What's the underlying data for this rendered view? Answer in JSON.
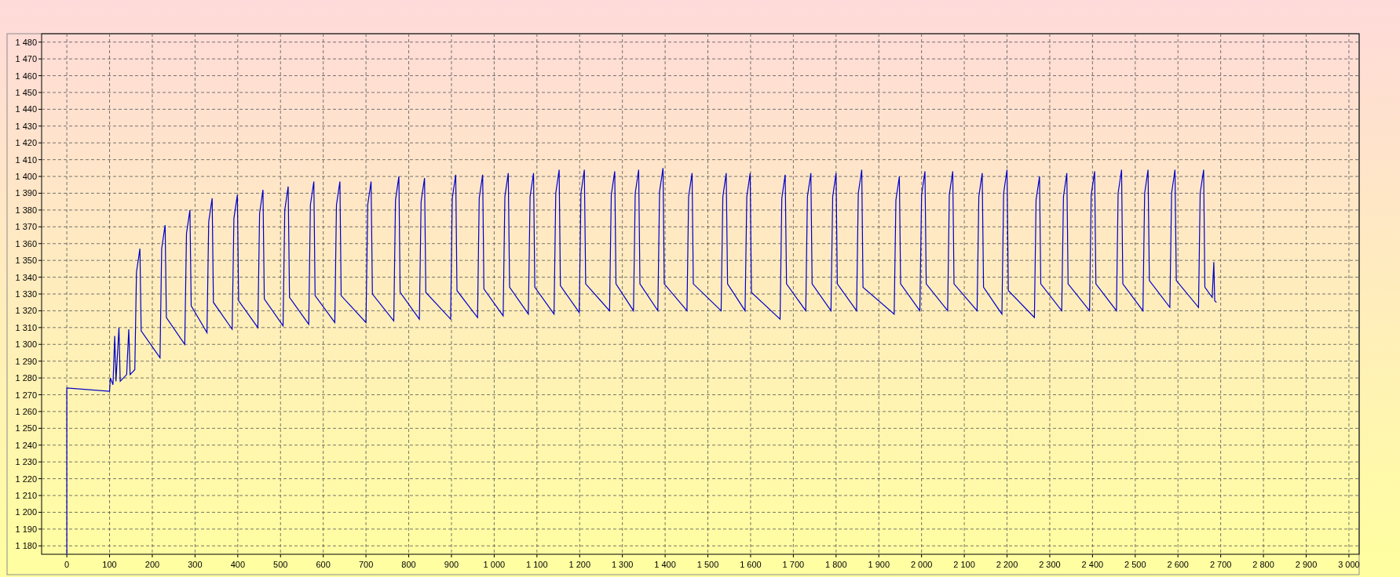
{
  "chart": {
    "chart_data": {
      "type": "line",
      "grid": true,
      "xlim": [
        -59,
        3024
      ],
      "ylim": [
        1175,
        1485
      ],
      "xticks": [
        {
          "value": 0,
          "label": "0"
        },
        {
          "value": 100,
          "label": "100"
        },
        {
          "value": 200,
          "label": "200"
        },
        {
          "value": 300,
          "label": "300"
        },
        {
          "value": 400,
          "label": "400"
        },
        {
          "value": 500,
          "label": "500"
        },
        {
          "value": 600,
          "label": "600"
        },
        {
          "value": 700,
          "label": "700"
        },
        {
          "value": 800,
          "label": "800"
        },
        {
          "value": 900,
          "label": "900"
        },
        {
          "value": 1000,
          "label": "1 000"
        },
        {
          "value": 1100,
          "label": "1 100"
        },
        {
          "value": 1200,
          "label": "1 200"
        },
        {
          "value": 1300,
          "label": "1 300"
        },
        {
          "value": 1400,
          "label": "1 400"
        },
        {
          "value": 1500,
          "label": "1 500"
        },
        {
          "value": 1600,
          "label": "1 600"
        },
        {
          "value": 1700,
          "label": "1 700"
        },
        {
          "value": 1800,
          "label": "1 800"
        },
        {
          "value": 1900,
          "label": "1 900"
        },
        {
          "value": 2000,
          "label": "2 000"
        },
        {
          "value": 2100,
          "label": "2 100"
        },
        {
          "value": 2200,
          "label": "2 200"
        },
        {
          "value": 2300,
          "label": "2 300"
        },
        {
          "value": 2400,
          "label": "2 400"
        },
        {
          "value": 2500,
          "label": "2 500"
        },
        {
          "value": 2600,
          "label": "2 600"
        },
        {
          "value": 2700,
          "label": "2 700"
        },
        {
          "value": 2800,
          "label": "2 800"
        },
        {
          "value": 2900,
          "label": "2 900"
        },
        {
          "value": 3000,
          "label": "3 000"
        }
      ],
      "yticks": [
        {
          "value": 1180,
          "label": "1 180"
        },
        {
          "value": 1190,
          "label": "1 190"
        },
        {
          "value": 1200,
          "label": "1 200"
        },
        {
          "value": 1210,
          "label": "1 210"
        },
        {
          "value": 1220,
          "label": "1 220"
        },
        {
          "value": 1230,
          "label": "1 230"
        },
        {
          "value": 1240,
          "label": "1 240"
        },
        {
          "value": 1250,
          "label": "1 250"
        },
        {
          "value": 1260,
          "label": "1 260"
        },
        {
          "value": 1270,
          "label": "1 270"
        },
        {
          "value": 1280,
          "label": "1 280"
        },
        {
          "value": 1290,
          "label": "1 290"
        },
        {
          "value": 1300,
          "label": "1 300"
        },
        {
          "value": 1310,
          "label": "1 310"
        },
        {
          "value": 1320,
          "label": "1 320"
        },
        {
          "value": 1330,
          "label": "1 330"
        },
        {
          "value": 1340,
          "label": "1 340"
        },
        {
          "value": 1350,
          "label": "1 350"
        },
        {
          "value": 1360,
          "label": "1 360"
        },
        {
          "value": 1370,
          "label": "1 370"
        },
        {
          "value": 1380,
          "label": "1 380"
        },
        {
          "value": 1390,
          "label": "1 390"
        },
        {
          "value": 1400,
          "label": "1 400"
        },
        {
          "value": 1410,
          "label": "1 410"
        },
        {
          "value": 1420,
          "label": "1 420"
        },
        {
          "value": 1430,
          "label": "1 430"
        },
        {
          "value": 1440,
          "label": "1 440"
        },
        {
          "value": 1450,
          "label": "1 450"
        },
        {
          "value": 1460,
          "label": "1 460"
        },
        {
          "value": 1470,
          "label": "1 470"
        },
        {
          "value": 1480,
          "label": "1 480"
        }
      ],
      "x": [
        0,
        0,
        100,
        102,
        108,
        112,
        115,
        122,
        125,
        140,
        145,
        148,
        159,
        163,
        171,
        174,
        218,
        222,
        230,
        233,
        276,
        280,
        288,
        291,
        328,
        332,
        340,
        343,
        387,
        391,
        399,
        402,
        447,
        451,
        459,
        462,
        506,
        510,
        518,
        521,
        566,
        570,
        578,
        581,
        627,
        631,
        639,
        642,
        700,
        704,
        712,
        715,
        765,
        769,
        777,
        780,
        825,
        829,
        837,
        840,
        898,
        902,
        910,
        913,
        961,
        965,
        973,
        976,
        1021,
        1025,
        1033,
        1036,
        1080,
        1084,
        1092,
        1095,
        1140,
        1144,
        1152,
        1155,
        1199,
        1203,
        1211,
        1214,
        1270,
        1274,
        1282,
        1285,
        1326,
        1330,
        1338,
        1341,
        1383,
        1387,
        1395,
        1398,
        1451,
        1455,
        1463,
        1466,
        1531,
        1535,
        1543,
        1546,
        1587,
        1591,
        1599,
        1602,
        1669,
        1673,
        1681,
        1684,
        1729,
        1733,
        1741,
        1744,
        1788,
        1792,
        1800,
        1803,
        1848,
        1852,
        1860,
        1863,
        1936,
        1940,
        1948,
        1951,
        1996,
        2000,
        2008,
        2011,
        2061,
        2065,
        2073,
        2076,
        2130,
        2134,
        2142,
        2145,
        2188,
        2192,
        2200,
        2203,
        2264,
        2268,
        2276,
        2279,
        2328,
        2332,
        2340,
        2343,
        2393,
        2397,
        2405,
        2408,
        2456,
        2460,
        2468,
        2471,
        2518,
        2522,
        2530,
        2533,
        2581,
        2585,
        2593,
        2596,
        2648,
        2652,
        2660,
        2663,
        2680,
        2684,
        2686,
        2690
      ],
      "series": [
        {
          "color": "#0000c8",
          "values": [
            1175,
            1274,
            1272,
            1280,
            1276,
            1305,
            1278,
            1310,
            1278,
            1282,
            1309,
            1282,
            1285,
            1343,
            1357,
            1308,
            1292,
            1357,
            1371,
            1316,
            1300,
            1366,
            1380,
            1323,
            1307,
            1373,
            1387,
            1325,
            1309,
            1375,
            1389,
            1326,
            1310,
            1378,
            1392,
            1327,
            1311,
            1380,
            1394,
            1328,
            1312,
            1383,
            1397,
            1329,
            1313,
            1383,
            1397,
            1329,
            1313,
            1383,
            1397,
            1330,
            1314,
            1386,
            1400,
            1331,
            1315,
            1385,
            1399,
            1331,
            1315,
            1387,
            1401,
            1332,
            1316,
            1387,
            1401,
            1333,
            1317,
            1388,
            1402,
            1334,
            1318,
            1388,
            1402,
            1334,
            1318,
            1390,
            1404,
            1335,
            1319,
            1390,
            1404,
            1336,
            1320,
            1389,
            1403,
            1336,
            1320,
            1390,
            1404,
            1336,
            1320,
            1391,
            1405,
            1336,
            1320,
            1388,
            1402,
            1336,
            1320,
            1388,
            1402,
            1336,
            1320,
            1388,
            1402,
            1331,
            1315,
            1387,
            1401,
            1336,
            1320,
            1388,
            1402,
            1336,
            1320,
            1388,
            1402,
            1336,
            1320,
            1390,
            1404,
            1334,
            1318,
            1386,
            1400,
            1336,
            1320,
            1389,
            1403,
            1336,
            1320,
            1389,
            1403,
            1336,
            1320,
            1388,
            1402,
            1334,
            1318,
            1390,
            1404,
            1332,
            1316,
            1386,
            1400,
            1336,
            1320,
            1388,
            1402,
            1336,
            1320,
            1389,
            1403,
            1336,
            1320,
            1390,
            1404,
            1336,
            1320,
            1390,
            1404,
            1338,
            1322,
            1390,
            1404,
            1338,
            1322,
            1390,
            1404,
            1334,
            1328,
            1349,
            1326,
            1325
          ]
        }
      ]
    }
  }
}
